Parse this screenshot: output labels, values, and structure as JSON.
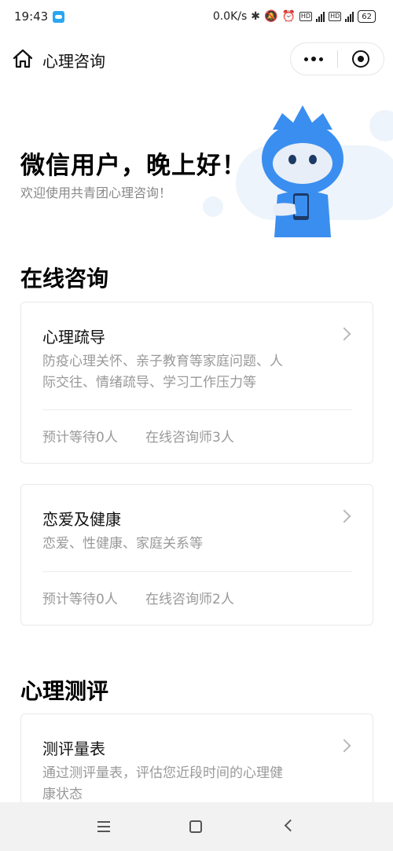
{
  "status_bar": {
    "time": "19:43",
    "net_speed": "0.0K/s",
    "net_type_1": "4G",
    "net_type_2": "4G",
    "hd_label": "HD",
    "battery": "62"
  },
  "nav": {
    "title": "心理咨询"
  },
  "hero": {
    "greeting": "微信用户，晚上好！",
    "welcome": "欢迎使用共青团心理咨询！"
  },
  "sections": {
    "online": "在线咨询",
    "assessment": "心理测评"
  },
  "cards": [
    {
      "title": "心理疏导",
      "desc_line1": "防疫心理关怀、亲子教育等家庭问题、人",
      "desc_line2": "际交往、情绪疏导、学习工作压力等",
      "wait": "预计等待0人",
      "counselors": "在线咨询师3人"
    },
    {
      "title": "恋爱及健康",
      "desc_line1": "恋爱、性健康、家庭关系等",
      "wait": "预计等待0人",
      "counselors": "在线咨询师2人"
    },
    {
      "title": "测评量表",
      "desc_line1": "通过测评量表，评估您近段时间的心理健",
      "desc_line2": "康状态"
    }
  ],
  "colors": {
    "mascot_blue": "#3a8ef0",
    "hero_bg": "#eef4fb",
    "muted_text": "#999999"
  }
}
